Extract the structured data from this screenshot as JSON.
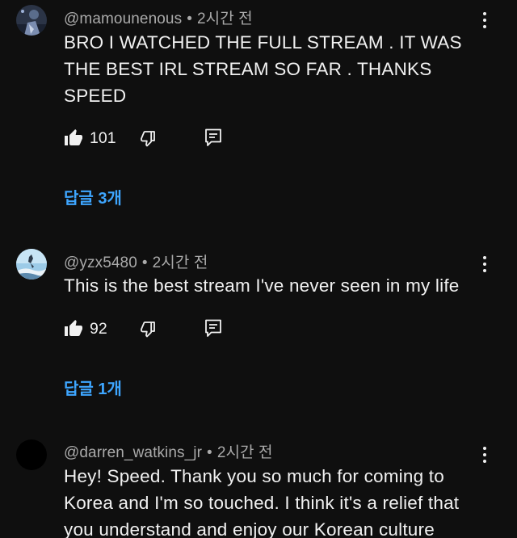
{
  "comments": [
    {
      "username": "@mamounenous",
      "time": "2시간 전",
      "text": "BRO I WATCHED THE FULL STREAM . IT WAS THE BEST IRL STREAM SO FAR . THANKS SPEED",
      "likes": "101",
      "replies_label": "답글 3개"
    },
    {
      "username": "@yzx5480",
      "time": "2시간 전",
      "text": "This is the best stream I've never seen in my life",
      "likes": "92",
      "replies_label": "답글 1개"
    },
    {
      "username": "@darren_watkins_jr",
      "time": "2시간 전",
      "text": "Hey! Speed. Thank you so much for coming to Korea and I'm so touched. I think it's a relief that you understand and enjoy our Korean culture"
    }
  ],
  "meta_separator": "•",
  "colors": {
    "background": "#0f0f0f",
    "text": "#f1f1f1",
    "meta": "#aaaaaa",
    "link": "#3ea6ff"
  },
  "icons": {
    "like": "thumbs-up-filled-icon",
    "dislike": "thumbs-down-outline-icon",
    "reply": "comment-reply-icon",
    "more": "more-vertical-icon"
  }
}
